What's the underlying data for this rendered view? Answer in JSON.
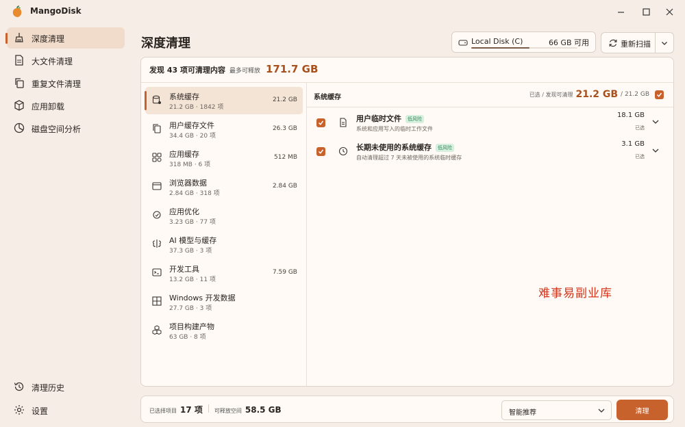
{
  "app": {
    "title": "MangoDisk",
    "accent": "#c8622c"
  },
  "window": {
    "minimize": "—",
    "maximize": "☐",
    "close": "✕"
  },
  "sidebar": {
    "items": [
      {
        "label": "深度清理",
        "icon": "broom-icon",
        "active": true
      },
      {
        "label": "大文件清理",
        "icon": "document-icon"
      },
      {
        "label": "重复文件清理",
        "icon": "copy-icon"
      },
      {
        "label": "应用卸载",
        "icon": "package-icon"
      },
      {
        "label": "磁盘空间分析",
        "icon": "pie-chart-icon"
      }
    ],
    "bottom": [
      {
        "label": "清理历史",
        "icon": "history-icon"
      },
      {
        "label": "设置",
        "icon": "gear-icon"
      }
    ]
  },
  "header": {
    "title": "深度清理",
    "disk": {
      "name": "Local Disk (C)",
      "free": "66 GB 可用",
      "used_fraction": 0.55
    },
    "rescan_label": "重新扫描"
  },
  "summary": {
    "found": "发现 43 项可清理内容",
    "up_to": "最多可释放",
    "total": "171.7 GB"
  },
  "categories": [
    {
      "name": "系统缓存",
      "sub": "21.2 GB · 1842 项",
      "size": "21.2 GB",
      "icon": "database-icon",
      "active": true
    },
    {
      "name": "用户缓存文件",
      "sub": "34.4 GB · 20 项",
      "size": "26.3 GB",
      "icon": "files-icon"
    },
    {
      "name": "应用缓存",
      "sub": "318 MB · 6 项",
      "size": "512 MB",
      "icon": "apps-icon"
    },
    {
      "name": "浏览器数据",
      "sub": "2.84 GB · 318 项",
      "size": "2.84 GB",
      "icon": "browser-icon"
    },
    {
      "name": "应用优化",
      "sub": "3.23 GB · 77 项",
      "size": "",
      "icon": "optimize-icon"
    },
    {
      "name": "AI 模型与缓存",
      "sub": "37.3 GB · 3 项",
      "size": "",
      "icon": "ai-icon"
    },
    {
      "name": "开发工具",
      "sub": "13.2 GB · 11 项",
      "size": "7.59 GB",
      "icon": "terminal-icon"
    },
    {
      "name": "Windows 开发数据",
      "sub": "27.7 GB · 3 项",
      "size": "",
      "icon": "windows-icon"
    },
    {
      "name": "项目构建产物",
      "sub": "63 GB · 8 项",
      "size": "",
      "icon": "cubes-icon"
    }
  ],
  "detail": {
    "title": "系统缓存",
    "selected_label": "已选 / 发现可清理",
    "selected_value": "21.2 GB",
    "selected_total": "/ 21.2 GB",
    "items": [
      {
        "name": "用户临时文件",
        "tag": "低风险",
        "desc": "系统和应用写入的临时工作文件",
        "size": "18.1 GB",
        "state": "已选",
        "icon": "temp-file-icon"
      },
      {
        "name": "长期未使用的系统缓存",
        "tag": "低风险",
        "desc": "自动清理超过 7 天未被使用的系统临时缓存",
        "size": "3.1 GB",
        "state": "已选",
        "icon": "clock-icon"
      }
    ]
  },
  "watermark": "难事易副业库",
  "footer": {
    "selected_label": "已选择项目",
    "selected_count": "17 项",
    "freeable_label": "可释放空间",
    "freeable_value": "58.5 GB",
    "mode": "智能推荐",
    "clean_label": "清理"
  }
}
